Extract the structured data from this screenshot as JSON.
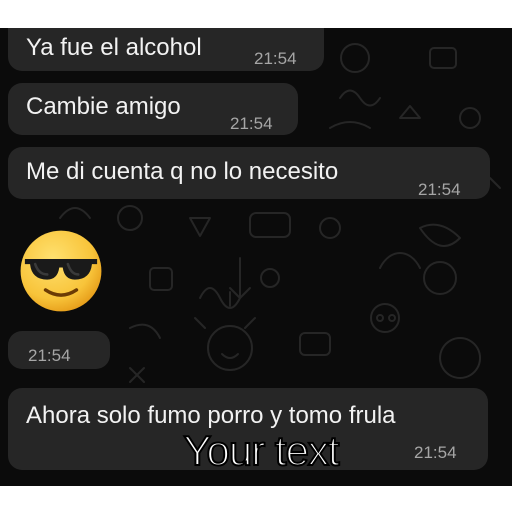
{
  "messages": [
    {
      "text": "Ya fue el alcohol",
      "time": "21:54"
    },
    {
      "text": "Cambie amigo",
      "time": "21:54"
    },
    {
      "text": "Me di cuenta q no lo necesito",
      "time": "21:54"
    },
    {
      "emoji": "smiling-face-with-sunglasses",
      "time": "21:54"
    },
    {
      "text": "Ahora solo fumo porro y tomo frula",
      "time": "21:54"
    }
  ],
  "caption": "Your text",
  "colors": {
    "chat_background": "#0b0b0b",
    "bubble": "#262626",
    "message_text": "#f2f2f2",
    "timestamp": "#a6a6a6"
  }
}
